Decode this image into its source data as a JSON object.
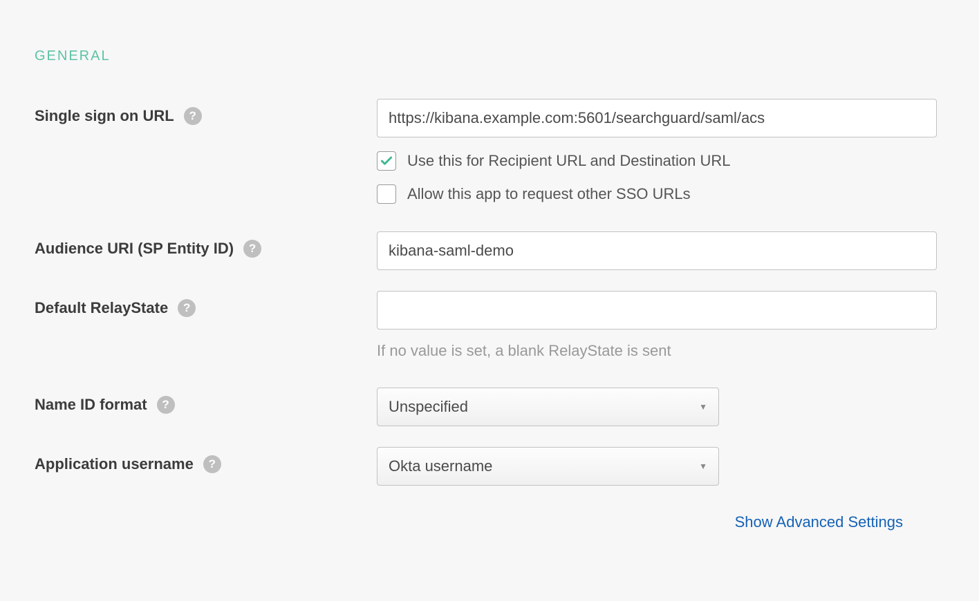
{
  "section": {
    "title": "GENERAL"
  },
  "fields": {
    "sso_url": {
      "label": "Single sign on URL",
      "value": "https://kibana.example.com:5601/searchguard/saml/acs",
      "checkbox1": {
        "label": "Use this for Recipient URL and Destination URL",
        "checked": true
      },
      "checkbox2": {
        "label": "Allow this app to request other SSO URLs",
        "checked": false
      }
    },
    "audience_uri": {
      "label": "Audience URI (SP Entity ID)",
      "value": "kibana-saml-demo"
    },
    "relay_state": {
      "label": "Default RelayState",
      "value": "",
      "hint": "If no value is set, a blank RelayState is sent"
    },
    "name_id_format": {
      "label": "Name ID format",
      "value": "Unspecified"
    },
    "app_username": {
      "label": "Application username",
      "value": "Okta username"
    }
  },
  "advanced_link": "Show Advanced Settings"
}
